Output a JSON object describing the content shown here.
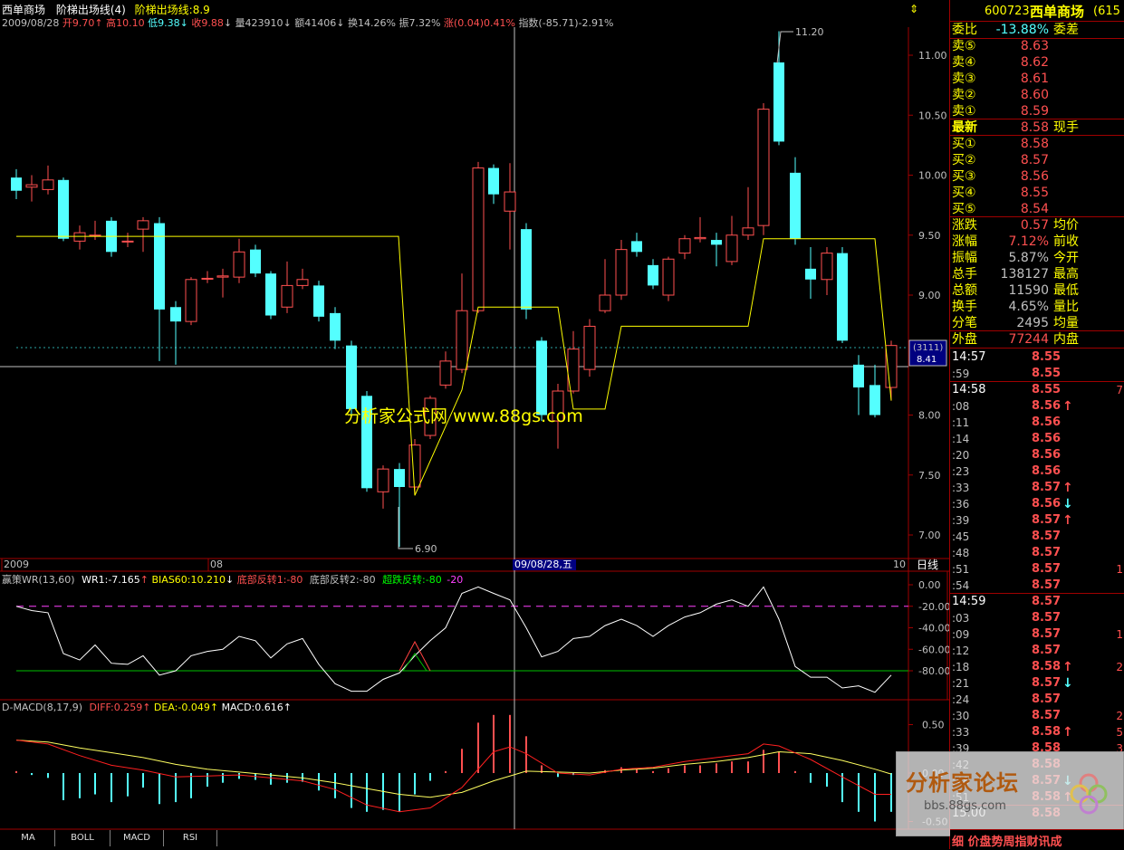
{
  "header": {
    "stock_name": "西单商场",
    "indicator_name": "阶梯出场线(4)",
    "indicator_value": "阶梯出场线:8.9",
    "date": "2009/08/28",
    "open": "开9.70",
    "high": "高10.10",
    "low": "低9.38",
    "close": "收9.88",
    "volume": "量423910",
    "amount": "额41406",
    "turnover": "换14.26%",
    "amplitude": "振7.32%",
    "change": "涨(0.04)0.41%",
    "index": "指数(-85.71)-2.91%"
  },
  "main_chart": {
    "y_ticks": [
      "11.00",
      "10.50",
      "10.00",
      "9.50",
      "9.00",
      "8.50",
      "8.00",
      "7.50",
      "7.00"
    ],
    "max_label": "11.20",
    "min_label": "6.90",
    "price_tag_top": "(3111)",
    "price_tag_bottom": "8.41",
    "x_labels": [
      "2009",
      "08",
      "09/08/28,五",
      "10"
    ],
    "period": "日线",
    "watermark": "分析家公式网 www.88gs.com"
  },
  "wr_panel": {
    "title": "赢策WR(13,60)",
    "wr1": "WR1:-7.165",
    "bias": "BIAS60:10.210",
    "bottom1": "底部反转1:-80",
    "bottom2": "底部反转2:-80",
    "oversold": "超跌反转:-80",
    "level": "-20",
    "y_ticks": [
      "0.00",
      "-20.00",
      "-40.00",
      "-60.00",
      "-80.00"
    ]
  },
  "macd_panel": {
    "title": "D-MACD(8,17,9)",
    "diff": "DIFF:0.259",
    "dea": "DEA:-0.049",
    "macd": "MACD:0.616",
    "y_ticks": [
      "0.50",
      "0.00",
      "-0.50"
    ]
  },
  "tabs": [
    "MA",
    "BOLL",
    "MACD",
    "RSI"
  ],
  "right_panel": {
    "code": "600723",
    "name": "西单商场",
    "code_suffix": "(615",
    "weibi_label": "委比",
    "weibi_value": "-13.88%",
    "weicha_label": "委差",
    "sell": [
      {
        "label": "卖⑤",
        "price": "8.63"
      },
      {
        "label": "卖④",
        "price": "8.62"
      },
      {
        "label": "卖③",
        "price": "8.61"
      },
      {
        "label": "卖②",
        "price": "8.60"
      },
      {
        "label": "卖①",
        "price": "8.59"
      }
    ],
    "latest_label": "最新",
    "latest_price": "8.58",
    "xianshou_label": "现手",
    "buy": [
      {
        "label": "买①",
        "price": "8.58"
      },
      {
        "label": "买②",
        "price": "8.57"
      },
      {
        "label": "买③",
        "price": "8.56"
      },
      {
        "label": "买④",
        "price": "8.55"
      },
      {
        "label": "买⑤",
        "price": "8.54"
      }
    ],
    "stats": [
      {
        "label": "涨跌",
        "value": "0.57",
        "label2": "均价"
      },
      {
        "label": "涨幅",
        "value": "7.12%",
        "label2": "前收"
      },
      {
        "label": "振幅",
        "value": "5.87%",
        "label2": "今开"
      },
      {
        "label": "总手",
        "value": "138127",
        "label2": "最高"
      },
      {
        "label": "总额",
        "value": "11590",
        "label2": "最低"
      },
      {
        "label": "换手",
        "value": "4.65%",
        "label2": "量比"
      },
      {
        "label": "分笔",
        "value": "2495",
        "label2": "均量"
      }
    ],
    "waipan_label": "外盘",
    "waipan_value": "77244",
    "neipan_label": "内盘",
    "ticks": [
      {
        "time": "14:57",
        "price": "8.55",
        "arrow": "",
        "vol": ""
      },
      {
        "time": ":59",
        "price": "8.55",
        "arrow": "",
        "vol": ""
      },
      {
        "time": "14:58",
        "price": "8.55",
        "arrow": "",
        "vol": "7"
      },
      {
        "time": ":08",
        "price": "8.56",
        "arrow": "↑",
        "vol": ""
      },
      {
        "time": ":11",
        "price": "8.56",
        "arrow": "",
        "vol": ""
      },
      {
        "time": ":14",
        "price": "8.56",
        "arrow": "",
        "vol": ""
      },
      {
        "time": ":20",
        "price": "8.56",
        "arrow": "",
        "vol": ""
      },
      {
        "time": ":23",
        "price": "8.56",
        "arrow": "",
        "vol": ""
      },
      {
        "time": ":33",
        "price": "8.57",
        "arrow": "↑",
        "vol": ""
      },
      {
        "time": ":36",
        "price": "8.56",
        "arrow": "↓",
        "vol": ""
      },
      {
        "time": ":39",
        "price": "8.57",
        "arrow": "↑",
        "vol": ""
      },
      {
        "time": ":45",
        "price": "8.57",
        "arrow": "",
        "vol": ""
      },
      {
        "time": ":48",
        "price": "8.57",
        "arrow": "",
        "vol": ""
      },
      {
        "time": ":51",
        "price": "8.57",
        "arrow": "",
        "vol": "1"
      },
      {
        "time": ":54",
        "price": "8.57",
        "arrow": "",
        "vol": ""
      },
      {
        "time": "14:59",
        "price": "8.57",
        "arrow": "",
        "vol": ""
      },
      {
        "time": ":03",
        "price": "8.57",
        "arrow": "",
        "vol": ""
      },
      {
        "time": ":09",
        "price": "8.57",
        "arrow": "",
        "vol": "1"
      },
      {
        "time": ":12",
        "price": "8.57",
        "arrow": "",
        "vol": ""
      },
      {
        "time": ":18",
        "price": "8.58",
        "arrow": "↑",
        "vol": "2"
      },
      {
        "time": ":21",
        "price": "8.57",
        "arrow": "↓",
        "vol": ""
      },
      {
        "time": ":24",
        "price": "8.57",
        "arrow": "",
        "vol": ""
      },
      {
        "time": ":30",
        "price": "8.57",
        "arrow": "",
        "vol": "2"
      },
      {
        "time": ":33",
        "price": "8.58",
        "arrow": "↑",
        "vol": "5"
      },
      {
        "time": ":39",
        "price": "8.58",
        "arrow": "",
        "vol": "3"
      },
      {
        "time": ":42",
        "price": "8.58",
        "arrow": "",
        "vol": ""
      },
      {
        "time": ":48",
        "price": "8.57",
        "arrow": "↓",
        "vol": ""
      },
      {
        "time": ":51",
        "price": "8.58",
        "arrow": "↑",
        "vol": ""
      },
      {
        "time": "15:00",
        "price": "8.58",
        "arrow": "",
        "vol": ""
      }
    ],
    "bottom_tabs": "细 价盘势周指财讯成",
    "forum_logo": "分析家论坛",
    "forum_url": "bbs.88gs.com"
  },
  "colors": {
    "up": "#ff5050",
    "down": "#54ffff",
    "stair": "#ffff00",
    "grid": "#a00000"
  }
}
